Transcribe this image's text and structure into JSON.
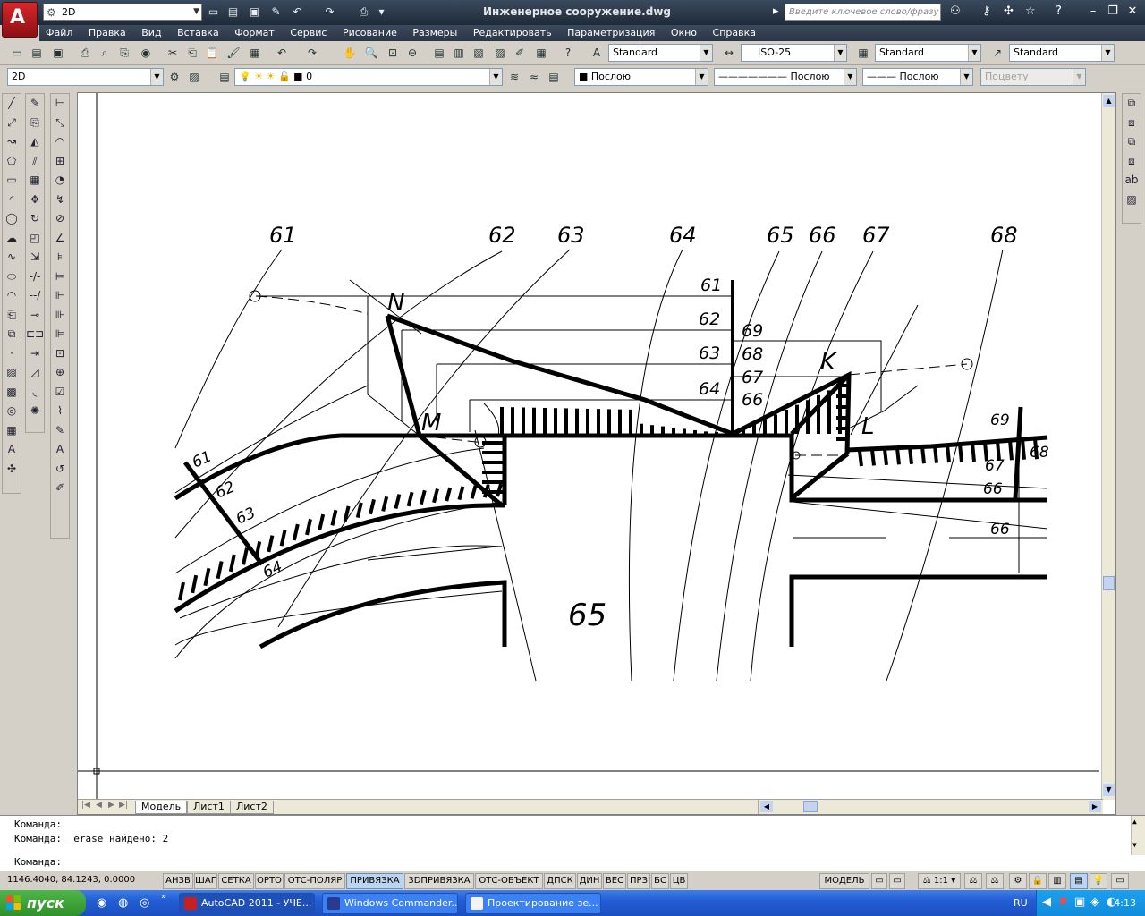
{
  "app": {
    "logo_letter": "A",
    "workspace": "2D",
    "title": "Инженерное сооружение.dwg",
    "search_placeholder": "Введите ключевое слово/фразу"
  },
  "menu": [
    "Файл",
    "Правка",
    "Вид",
    "Вставка",
    "Формат",
    "Сервис",
    "Рисование",
    "Размеры",
    "Редактировать",
    "Параметризация",
    "Окно",
    "Справка"
  ],
  "styles": {
    "text_style": "Standard",
    "dim_style": "ISO-25",
    "table_style": "Standard",
    "multileader_style": "Standard"
  },
  "layers": {
    "workspace": "2D",
    "current_layer": "0",
    "color": "Послою",
    "linetype": "Послою",
    "lineweight": "Послою",
    "plot_style": "Поцвету"
  },
  "drawing": {
    "top_labels": [
      "61",
      "62",
      "63",
      "64",
      "65",
      "66",
      "67",
      "68"
    ],
    "scale_left": [
      "61",
      "62",
      "63",
      "64"
    ],
    "scale_right": [
      "69",
      "68",
      "67",
      "66"
    ],
    "road_left": [
      "61",
      "62",
      "63",
      "64"
    ],
    "road_right": [
      "69",
      "68",
      "67",
      "66",
      "66"
    ],
    "center_label": "65",
    "points": {
      "N": "N",
      "M": "M",
      "K": "K",
      "L": "L"
    }
  },
  "layout_tabs": [
    "Модель",
    "Лист1",
    "Лист2"
  ],
  "command": {
    "line1": "Команда:",
    "line2": "Команда: _erase найдено: 2",
    "prompt": "Команда:"
  },
  "status": {
    "coords": "1146.4040, 84.1243, 0.0000",
    "toggles": [
      {
        "label": "АНЗВ",
        "on": false
      },
      {
        "label": "ШАГ",
        "on": false
      },
      {
        "label": "СЕТКА",
        "on": false
      },
      {
        "label": "ОРТО",
        "on": false
      },
      {
        "label": "ОТС-ПОЛЯР",
        "on": false
      },
      {
        "label": "ПРИВЯЗКА",
        "on": true
      },
      {
        "label": "3DПРИВЯЗКА",
        "on": false
      },
      {
        "label": "ОТС-ОБЪЕКТ",
        "on": false
      },
      {
        "label": "ДПСК",
        "on": false
      },
      {
        "label": "ДИН",
        "on": false
      },
      {
        "label": "ВЕС",
        "on": false
      },
      {
        "label": "ПРЗ",
        "on": false
      },
      {
        "label": "БС",
        "on": false
      },
      {
        "label": "ЦВ",
        "on": false
      }
    ],
    "model_label": "МОДЕЛЬ",
    "scale": "1:1"
  },
  "taskbar": {
    "start": "пуск",
    "tasks": [
      {
        "label": "AutoCAD 2011 - УЧЕ...",
        "active": true,
        "icon_color": "#c8201e"
      },
      {
        "label": "Windows Commander...",
        "active": false,
        "icon_color": "#2a3a8c"
      },
      {
        "label": "Проектирование зе...",
        "active": false,
        "icon_color": "#f4f4f4"
      }
    ],
    "lang": "RU",
    "clock": "14:13"
  }
}
